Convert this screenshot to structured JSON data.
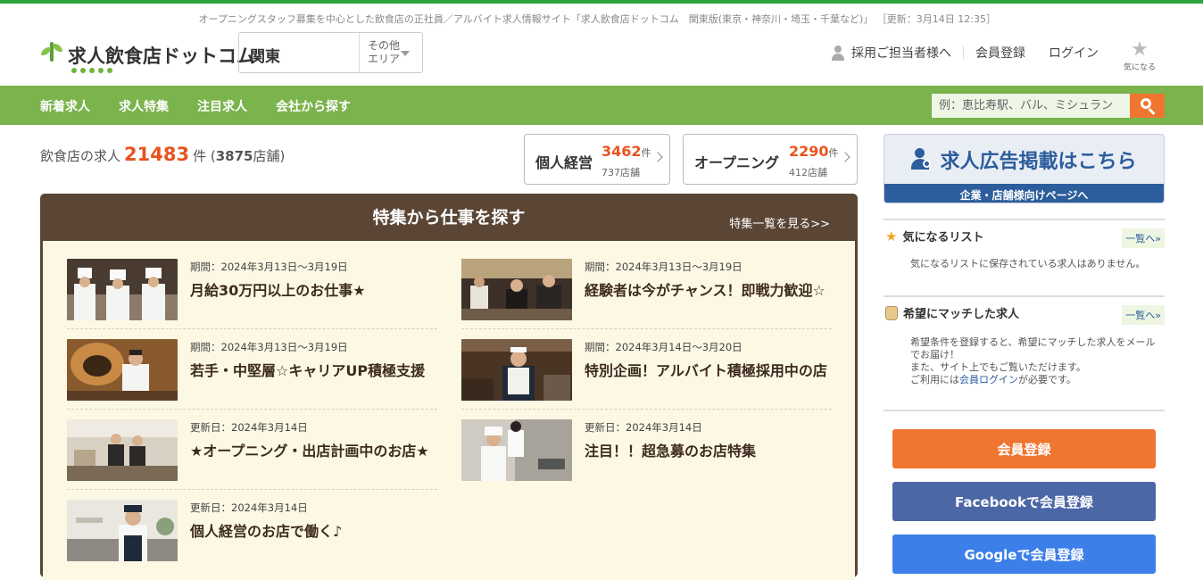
{
  "tagline": {
    "text": "オープニングスタッフ募集を中心とした飲食店の正社員／アルバイト求人情報サイト「求人飲食店ドットコム　関東版(東京・神奈川・埼玉・千葉など)」",
    "updated": "［更新：3月14日 12:35］"
  },
  "header": {
    "logo_text": "求人飲食店ドットコム",
    "area_current": "関東",
    "area_other_line1": "その他",
    "area_other_line2": "エリア",
    "recruiter_link": "採用ご担当者様へ",
    "register_link": "会員登録",
    "login_link": "ログイン",
    "favorite_label": "気になる"
  },
  "nav": {
    "items": [
      "新着求人",
      "求人特集",
      "注目求人",
      "会社から探す"
    ],
    "search_placeholder": "例：恵比寿駅、バル、ミシュラン"
  },
  "summary": {
    "prefix": "飲食店の求人",
    "count": "21483",
    "unit": "件",
    "shops_open": "(",
    "shops_num": "3875",
    "shops_unit": "店舗)"
  },
  "categories": [
    {
      "name": "個人経営",
      "count": "3462",
      "unit": "件",
      "shops": "737店舗"
    },
    {
      "name": "オープニング",
      "count": "2290",
      "unit": "件",
      "shops": "412店舗"
    }
  ],
  "feature": {
    "title": "特集から仕事を探す",
    "more": "特集一覧を見る>>",
    "cards": [
      {
        "date": "期間：2024年3月13日～3月19日",
        "title": "月給30万円以上のお仕事★"
      },
      {
        "date": "期間：2024年3月13日～3月19日",
        "title": "経験者は今がチャンス！即戦力歓迎☆"
      },
      {
        "date": "期間：2024年3月13日～3月19日",
        "title": "若手・中堅層☆キャリアUP積極支援"
      },
      {
        "date": "期間：2024年3月14日～3月20日",
        "title": "特別企画！アルバイト積極採用中の店"
      },
      {
        "date": "更新日：2024年3月14日",
        "title": "★オープニング・出店計画中のお店★"
      },
      {
        "date": "更新日：2024年3月14日",
        "title": "注目！！超急募のお店特集"
      },
      {
        "date": "更新日：2024年3月14日",
        "title": "個人経営のお店で働く♪"
      }
    ]
  },
  "sidebar": {
    "ad_title": "求人広告掲載はこちら",
    "ad_sub": "企業・店舗様向けページへ",
    "fav_title": "気になるリスト",
    "fav_link": "一覧へ»",
    "fav_text": "気になるリストに保存されている求人はありません。",
    "match_title": "希望にマッチした求人",
    "match_link": "一覧へ»",
    "match_text1": "希望条件を登録すると、希望にマッチした求人をメールでお届け！",
    "match_text2": "また、サイト上でもご覧いただけます。",
    "match_text3_pre": "ご利用には",
    "match_text3_link": "会員ログイン",
    "match_text3_post": "が必要です。",
    "btn_register": "会員登録",
    "btn_facebook": "Facebookで会員登録",
    "btn_google": "Googleで会員登録"
  },
  "colors": {
    "green": "#7bb34c",
    "orange": "#ef7630",
    "brown": "#5b4636",
    "blue": "#2c5d9c",
    "facebook": "#4b67a6",
    "google": "#3d7fe8"
  }
}
